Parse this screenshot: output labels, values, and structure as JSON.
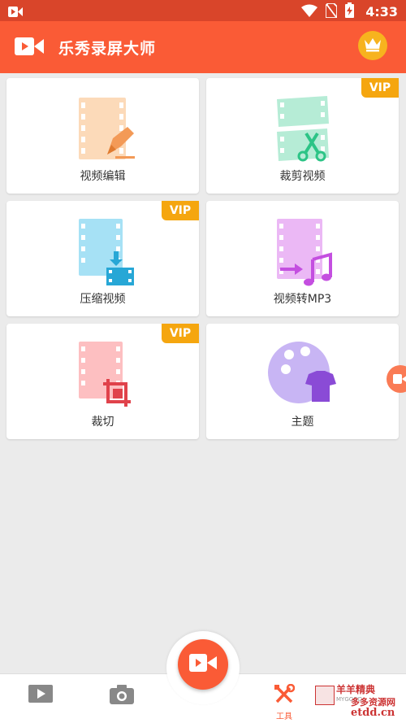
{
  "status_bar": {
    "time": "4:33"
  },
  "app": {
    "title": "乐秀录屏大师",
    "accent": "#fa5b36",
    "vip_color": "#f5a60f"
  },
  "tools": [
    {
      "label": "视频编辑",
      "vip": false,
      "icon": "video-edit-icon"
    },
    {
      "label": "裁剪视频",
      "vip": true,
      "vip_label": "VIP",
      "icon": "video-trim-icon"
    },
    {
      "label": "压缩视频",
      "vip": true,
      "vip_label": "VIP",
      "icon": "video-compress-icon"
    },
    {
      "label": "视频转MP3",
      "vip": false,
      "icon": "video-to-mp3-icon"
    },
    {
      "label": "裁切",
      "vip": true,
      "vip_label": "VIP",
      "icon": "crop-icon"
    },
    {
      "label": "主题",
      "vip": false,
      "icon": "theme-palette-icon"
    }
  ],
  "bottom_nav": {
    "tools_label": "工具"
  },
  "watermark": {
    "line1": "羊羊精典",
    "line2": "多多资源网",
    "line3": "etdd.cn",
    "small": "MYGOOD"
  }
}
